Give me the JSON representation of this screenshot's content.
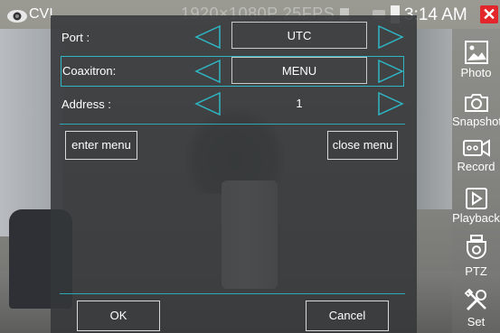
{
  "status_bar": {
    "app_label": "CVI",
    "resolution": "1920×1080P 25FPS",
    "clock": "3:14 AM",
    "close_symbol": "✕"
  },
  "toolbar": {
    "items": [
      {
        "label": "Photo",
        "icon": "photo-icon"
      },
      {
        "label": "Snapshot",
        "icon": "camera-icon"
      },
      {
        "label": "Record",
        "icon": "video-icon"
      },
      {
        "label": "Playback",
        "icon": "play-icon"
      },
      {
        "label": "PTZ",
        "icon": "ptz-icon"
      },
      {
        "label": "Set",
        "icon": "tools-icon"
      }
    ]
  },
  "dialog": {
    "port": {
      "label": "Port :",
      "value": "UTC"
    },
    "coaxitron": {
      "label": "Coaxitron:",
      "value": "MENU"
    },
    "address": {
      "label": "Address :",
      "value": "1"
    },
    "enter_menu_label": "enter menu",
    "close_menu_label": "close menu",
    "ok_label": "OK",
    "cancel_label": "Cancel"
  },
  "colors": {
    "accent": "#2fb7c5",
    "close_red": "#e2262b"
  }
}
